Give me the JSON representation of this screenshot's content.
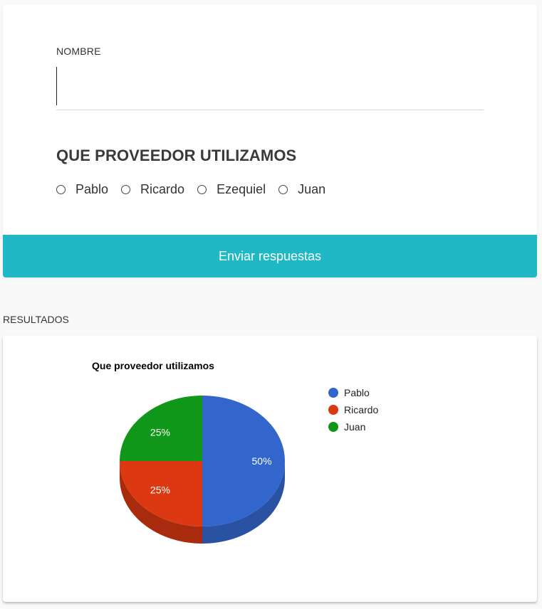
{
  "form": {
    "name_label": "NOMBRE",
    "name_value": "",
    "question": "QUE PROVEEDOR UTILIZAMOS",
    "options": [
      {
        "label": "Pablo"
      },
      {
        "label": "Ricardo"
      },
      {
        "label": "Ezequiel"
      },
      {
        "label": "Juan"
      }
    ],
    "submit_label": "Enviar respuestas",
    "accent_color": "#20b8c4"
  },
  "results": {
    "section_title": "RESULTADOS"
  },
  "chart_data": {
    "type": "pie",
    "title": "Que proveedor utilizamos",
    "is3D": true,
    "legend_position": "right",
    "slices": [
      {
        "label": "Pablo",
        "value": 50,
        "display": "50%",
        "color": "#3366cc",
        "side_color": "#2a52a3"
      },
      {
        "label": "Ricardo",
        "value": 25,
        "display": "25%",
        "color": "#dc3912",
        "side_color": "#a82b0e"
      },
      {
        "label": "Juan",
        "value": 25,
        "display": "25%",
        "color": "#109618",
        "side_color": "#0c7212"
      }
    ]
  }
}
